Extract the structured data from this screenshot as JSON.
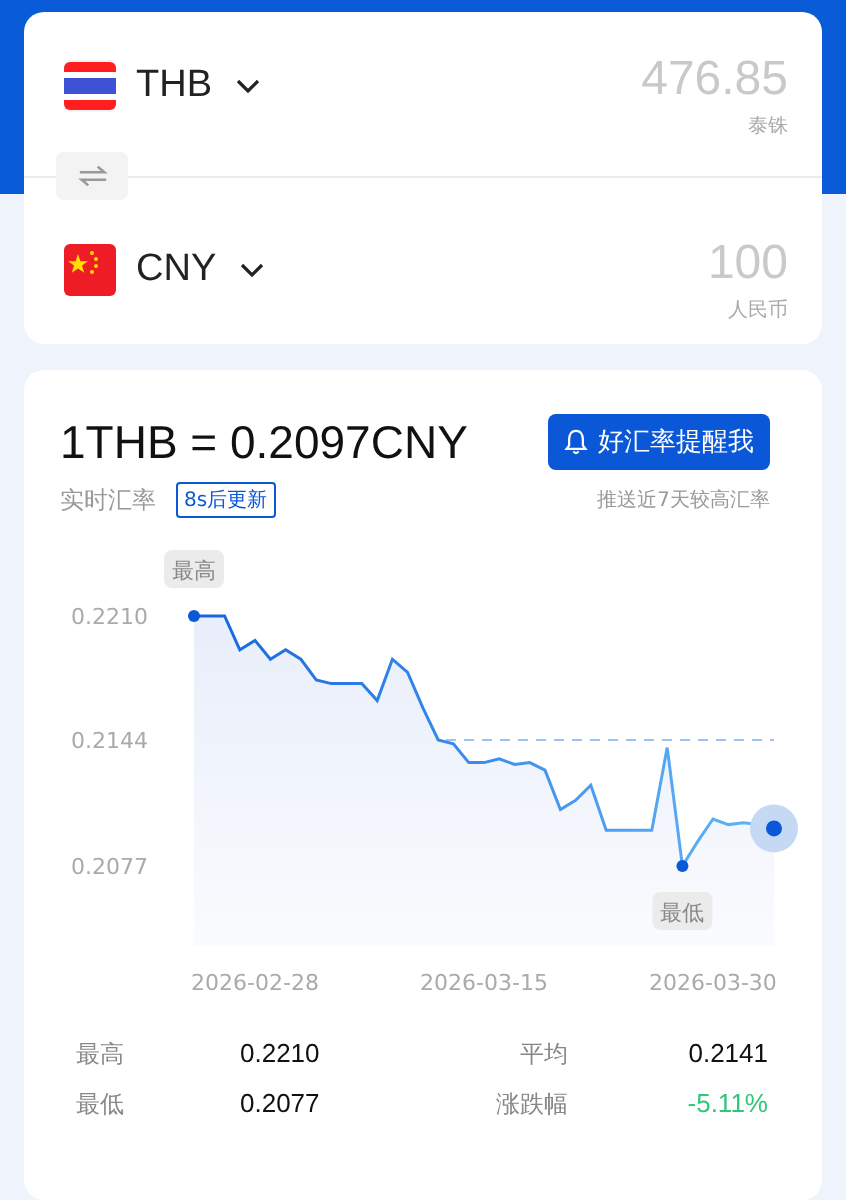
{
  "converter": {
    "rows": [
      {
        "code": "THB",
        "kind": "th",
        "amount": "476.85",
        "currency_name": "泰铢"
      },
      {
        "code": "CNY",
        "kind": "cn",
        "amount": "100",
        "currency_name": "人民币"
      }
    ]
  },
  "rate": {
    "headline": "1THB = 0.2097CNY",
    "label": "实时汇率",
    "update_badge": "8s后更新",
    "alert_button": "好汇率提醒我",
    "alert_hint": "推送近7天较高汇率"
  },
  "chart_data": {
    "type": "area",
    "ylim": [
      0.2077,
      0.221
    ],
    "categories": [
      null,
      null,
      null,
      null,
      "2026-02-28",
      null,
      null,
      null,
      null,
      null,
      null,
      null,
      null,
      null,
      null,
      null,
      null,
      null,
      null,
      "2026-03-15",
      null,
      null,
      null,
      null,
      null,
      null,
      null,
      null,
      null,
      null,
      null,
      null,
      null,
      null,
      "2026-03-30",
      null,
      null,
      null,
      null
    ],
    "series": [
      {
        "color": "#1565e0",
        "values": [
          0.221,
          0.221,
          0.221,
          0.2192,
          0.2197,
          0.2187,
          0.2192,
          0.2187,
          0.2176,
          0.2174,
          0.2174,
          0.2174,
          0.2165,
          0.2187,
          0.218,
          0.2161,
          0.2144,
          0.2142,
          0.2132,
          0.2132,
          0.2134,
          0.2131,
          0.2132,
          0.2128,
          0.2107,
          0.2112,
          0.212,
          0.2096,
          0.2096,
          0.2096,
          0.2096,
          0.214,
          0.2077,
          0.209,
          0.2102,
          0.2099,
          0.21,
          0.2099,
          0.2097
        ]
      }
    ],
    "yticks": [
      {
        "value": 0.2077,
        "label": "0.2077"
      },
      {
        "value": 0.2144,
        "label": "0.2144"
      },
      {
        "value": 0.221,
        "label": "0.2210"
      }
    ],
    "ref_lines": [
      {
        "axis": "y",
        "value": 0.2144
      }
    ],
    "annotations": [
      {
        "text": "最高",
        "y": 0.221
      },
      {
        "text": "最低",
        "y": 0.2077
      }
    ]
  },
  "stats": [
    {
      "label": "最高",
      "value": "0.2210",
      "kind": "value"
    },
    {
      "label": "平均",
      "value": "0.2141",
      "kind": "value"
    },
    {
      "label": "最低",
      "value": "0.2077",
      "kind": "value"
    },
    {
      "label": "涨跌幅",
      "value": "-5.11%",
      "kind": "change"
    }
  ]
}
